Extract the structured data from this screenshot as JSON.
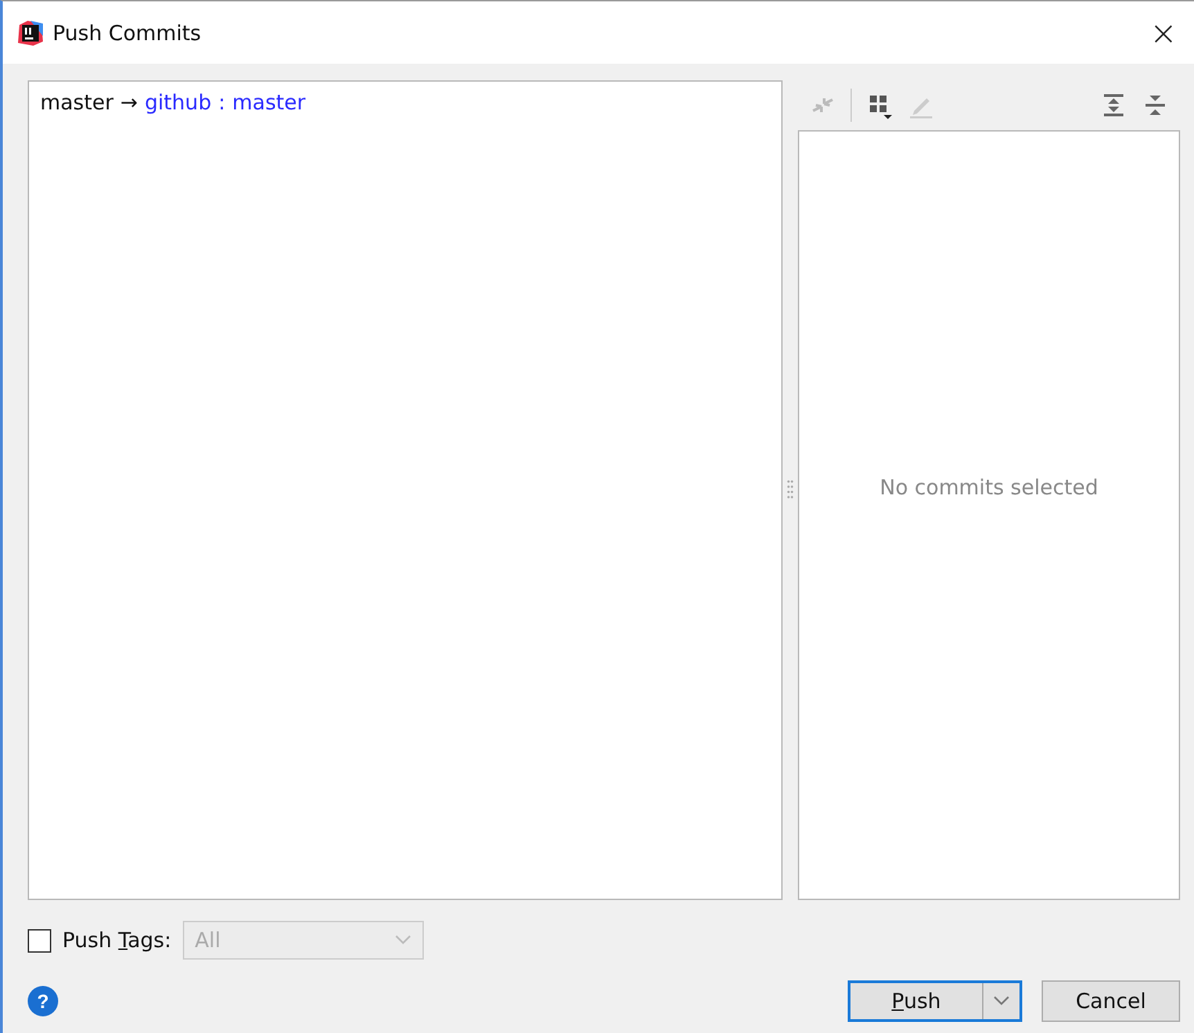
{
  "window": {
    "title": "Push Commits",
    "close": "×"
  },
  "push_target": {
    "local_branch": "master",
    "arrow": "→",
    "remote": "github",
    "separator": ":",
    "remote_branch": "master"
  },
  "details": {
    "empty_text": "No commits selected"
  },
  "push_tags": {
    "checked": false,
    "label": {
      "before": "Push ",
      "key": "T",
      "after": "ags:"
    },
    "dropdown": {
      "value": "All",
      "disabled": true
    }
  },
  "help": "?",
  "buttons": {
    "push": {
      "key": "P",
      "after": "ush"
    },
    "cancel": "Cancel"
  }
}
